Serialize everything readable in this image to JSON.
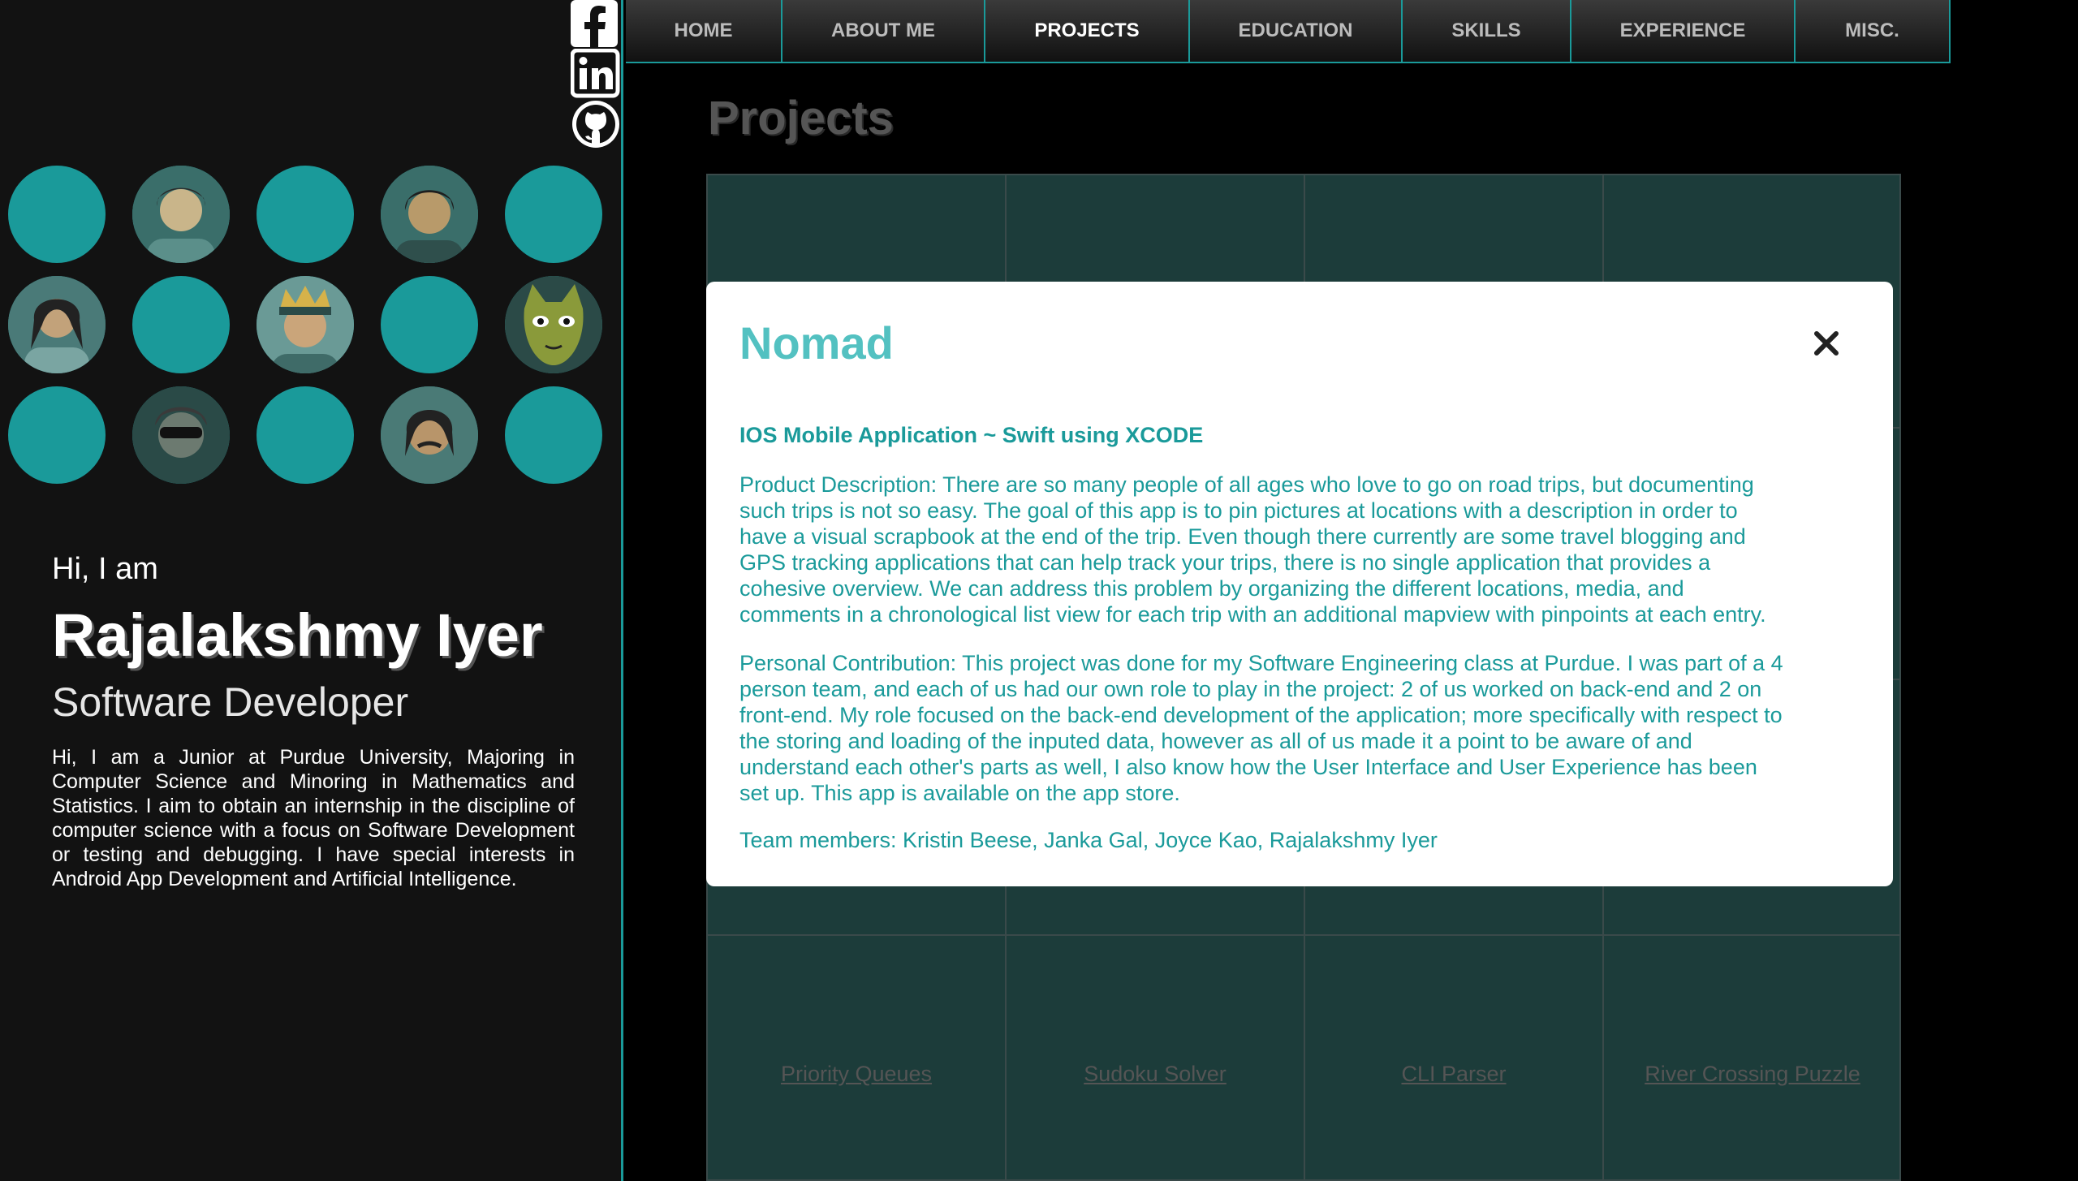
{
  "colors": {
    "accent": "#1a9a9a",
    "accent_light": "#53c1c1",
    "tile_bg": "#1c3c3a",
    "sidebar_bg": "#121212"
  },
  "social": [
    {
      "name": "facebook-icon"
    },
    {
      "name": "linkedin-icon"
    },
    {
      "name": "github-icon"
    }
  ],
  "sidebar": {
    "greeting": "Hi, I am",
    "name": "Rajalakshmy Iyer",
    "role": "Software Developer",
    "bio": "Hi, I am a Junior at Purdue University, Majoring in Computer Science and Minoring in Mathematics and Statistics. I aim to obtain an internship in the discipline of computer science with a focus on Software Development or testing and debugging. I have special interests in Android App Development and Artificial Intelligence."
  },
  "nav": {
    "items": [
      "HOME",
      "ABOUT ME",
      "PROJECTS",
      "EDUCATION",
      "SKILLS",
      "EXPERIENCE",
      "MISC."
    ],
    "active": "PROJECTS"
  },
  "page": {
    "title": "Projects"
  },
  "projects": {
    "bottom_row": [
      "Priority Queues",
      "Sudoku Solver",
      "CLI Parser",
      "River Crossing Puzzle"
    ]
  },
  "modal": {
    "title": "Nomad",
    "subtitle": "IOS Mobile Application ~ Swift using XCODE",
    "description": "Product Description: There are so many people of all ages who love to go on road trips, but documenting such trips is not so easy. The goal of this app is to pin pictures at locations with a description in order to have a visual scrapbook at the end of the trip. Even though there currently are some travel blogging and GPS tracking applications that can help track your trips, there is no single application that provides a cohesive overview. We can address this problem by organizing the different locations, media, and comments in a chronological list view for each trip with an additional mapview with pinpoints at each entry.",
    "contribution": "Personal Contribution: This project was done for my Software Engineering class at Purdue. I was part of a 4 person team, and each of us had our own role to play in the project: 2 of us worked on back-end and 2 on front-end. My role focused on the back-end development of the application; more specifically with respect to the storing and loading of the inputed data, however as all of us made it a point to be aware of and understand each other's parts as well, I also know how the User Interface and User Experience has been set up. This app is available on the app store.",
    "team": "Team members: Kristin Beese, Janka Gal, Joyce Kao, Rajalakshmy Iyer"
  }
}
